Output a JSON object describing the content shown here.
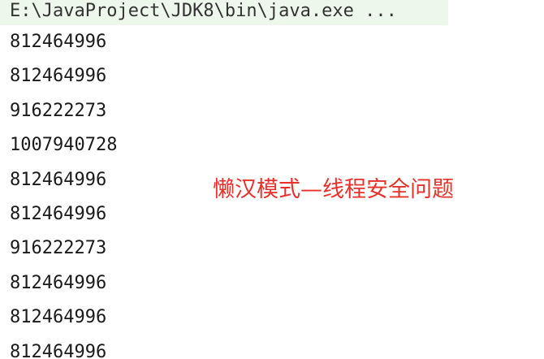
{
  "console": {
    "command": "E:\\JavaProject\\JDK8\\bin\\java.exe ...",
    "output_lines": [
      "812464996",
      "812464996",
      "916222273",
      "1007940728",
      "812464996",
      "812464996",
      "916222273",
      "812464996",
      "812464996",
      "812464996"
    ]
  },
  "annotation": {
    "text": "懒汉模式—线程安全问题",
    "color": "#e8312a"
  },
  "colors": {
    "command_bg": "#eef7ec",
    "text": "#1a1a1a"
  }
}
